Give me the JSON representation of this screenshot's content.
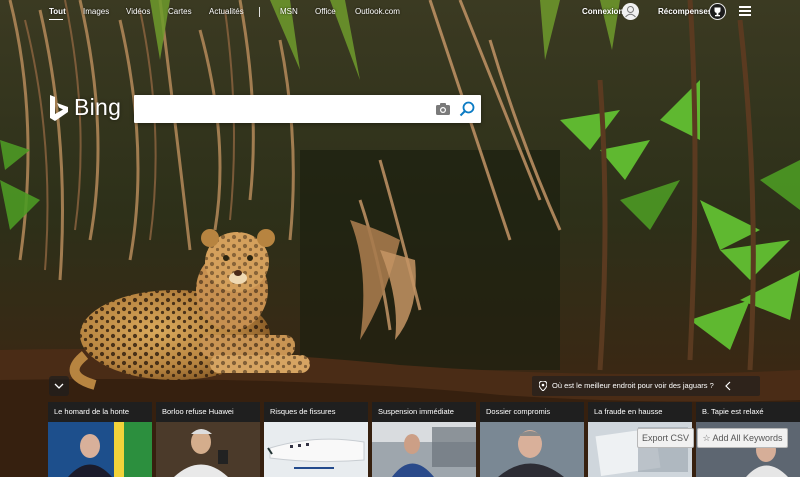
{
  "nav": {
    "tabs": [
      {
        "label": "Tout"
      },
      {
        "label": "Images"
      },
      {
        "label": "Vidéos"
      },
      {
        "label": "Cartes"
      },
      {
        "label": "Actualités"
      }
    ],
    "links": [
      {
        "label": "MSN"
      },
      {
        "label": "Office"
      },
      {
        "label": "Outlook.com"
      }
    ],
    "signin_label": "Connexion",
    "rewards_label": "Récompenses"
  },
  "logo": {
    "text": "Bing"
  },
  "search": {
    "value": "",
    "placeholder": ""
  },
  "question": {
    "text": "Où est le meilleur endroit pour voir des jaguars ?"
  },
  "news": {
    "cards": [
      {
        "title": "Le homard de la honte"
      },
      {
        "title": "Borloo refuse Huawei"
      },
      {
        "title": "Risques de fissures"
      },
      {
        "title": "Suspension immédiate"
      },
      {
        "title": "Dossier compromis"
      },
      {
        "title": "La fraude en hausse"
      },
      {
        "title": "B. Tapie est relaxé"
      }
    ]
  },
  "toolbar": {
    "export_label": "Export CSV",
    "keywords_label": "Add All Keywords"
  },
  "colors": {
    "accent": "#0b7bc4",
    "card_bg": "#1f1f1f",
    "overlay": "#1e1e1e"
  }
}
